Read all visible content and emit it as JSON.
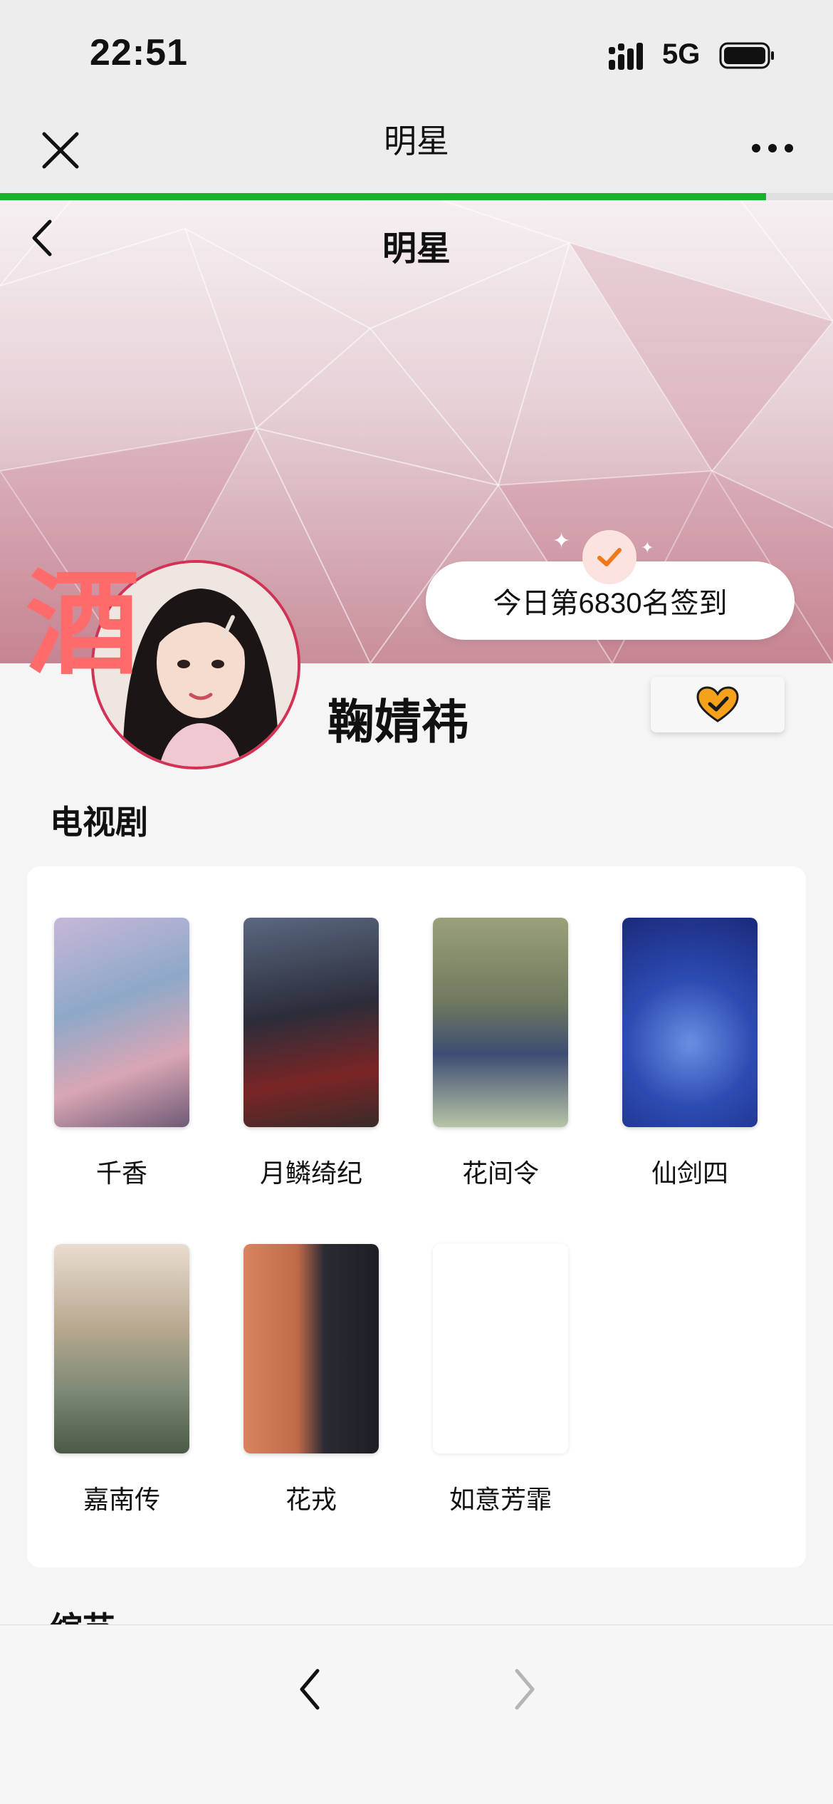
{
  "status_bar": {
    "time": "22:51",
    "network": "5G"
  },
  "topbar": {
    "title": "明星",
    "progress_percent": 92
  },
  "hero": {
    "title": "明星",
    "checkin_text": "今日第6830名签到"
  },
  "profile": {
    "name": "鞠婧祎",
    "stamp_text": "酒"
  },
  "sections": {
    "tv": {
      "title": "电视剧",
      "items": [
        {
          "label": "千香"
        },
        {
          "label": "月鳞绮纪"
        },
        {
          "label": "花间令"
        },
        {
          "label": "仙剑四"
        },
        {
          "label": "嘉南传"
        },
        {
          "label": "花戎"
        },
        {
          "label": "如意芳霏"
        }
      ]
    },
    "variety": {
      "title": "综艺"
    }
  },
  "colors": {
    "accent_green": "#17b42a",
    "avatar_border": "#d23256",
    "check_orange": "#f07a1a",
    "heart_orange": "#f5a21a"
  },
  "icons": [
    "close-icon",
    "more-icon",
    "back-icon",
    "check-icon",
    "heart-check-icon",
    "nav-back-icon",
    "nav-forward-icon"
  ]
}
